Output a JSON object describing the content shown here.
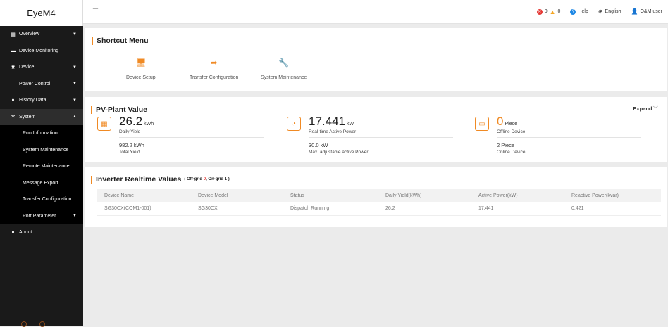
{
  "sidebar": {
    "brand": "EyeM4",
    "items": [
      {
        "label": "Overview",
        "icon": "grid-icon"
      },
      {
        "label": "Device Monitoring",
        "icon": "monitor-icon"
      },
      {
        "label": "Device",
        "icon": "tools-icon"
      },
      {
        "label": "Power Control",
        "icon": "power-icon"
      },
      {
        "label": "History Data",
        "icon": "history-icon"
      },
      {
        "label": "System",
        "icon": "gear-icon"
      }
    ],
    "system_sub": [
      {
        "label": "Run Information"
      },
      {
        "label": "System Maintenance"
      },
      {
        "label": "Remote Maintenance"
      },
      {
        "label": "Message Export"
      },
      {
        "label": "Transfer Configuration"
      },
      {
        "label": "Port Parameter"
      }
    ],
    "about": "About"
  },
  "topbar": {
    "fault_count": "0",
    "alarm_count": "0",
    "help": "Help",
    "language": "English",
    "user": "O&M user"
  },
  "shortcut": {
    "title": "Shortcut Menu",
    "items": [
      {
        "label": "Device Setup",
        "icon": "monitor-icon"
      },
      {
        "label": "Transfer Configuration",
        "icon": "share-arrow-icon"
      },
      {
        "label": "System Maintenance",
        "icon": "wrench-icon"
      }
    ]
  },
  "pv": {
    "title": "PV-Plant Value",
    "expand": "Expand",
    "metrics": [
      {
        "value": "26.2",
        "unit": "kWh",
        "label": "Daily Yield",
        "value2": "982.2 kWh",
        "label2": "Total Yield"
      },
      {
        "value": "17.441",
        "unit": "kW",
        "label": "Real-time Active Power",
        "value2": "30.0 kW",
        "label2": "Max. adjustable active Power"
      },
      {
        "value": "0",
        "unit": "Piece",
        "label": "Offline Device",
        "value2": "2 Piece",
        "label2": "Online Device"
      }
    ]
  },
  "inverter": {
    "title": "Inverter Realtime Values",
    "note_prefix": "( Off-grid ",
    "offgrid": "0",
    "note_mid": ", On-grid ",
    "ongrid": "1",
    "note_suffix": " )",
    "columns": [
      "Device Name",
      "Device Model",
      "Status",
      "Daily Yield(kWh)",
      "Active Power(kW)",
      "Reactive Power(kvar)"
    ],
    "rows": [
      [
        "SG30CX(COM1-001)",
        "SG30CX",
        "Dispatch Running",
        "26.2",
        "17.441",
        "0.421"
      ]
    ]
  },
  "colors": {
    "accent": "#f08a24",
    "sidebar": "#1a1a1a",
    "fault": "#e53935",
    "help": "#1e88e5"
  }
}
